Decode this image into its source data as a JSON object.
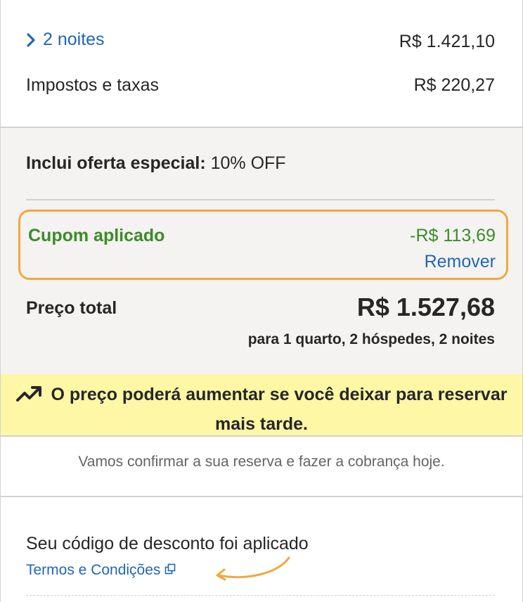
{
  "summary": {
    "nights_label": "2 noites",
    "nights_price": "R$ 1.421,10",
    "taxes_label": "Impostos e taxas",
    "taxes_price": "R$ 220,27"
  },
  "offer": {
    "label": "Inclui oferta especial:",
    "value": "10% OFF"
  },
  "coupon": {
    "label": "Cupom aplicado",
    "value": "-R$ 113,69",
    "remove_label": "Remover"
  },
  "total": {
    "label": "Preço total",
    "value": "R$ 1.527,68",
    "detail": "para 1 quarto, 2 hóspedes, 2 noites"
  },
  "warning": {
    "text": "O preço poderá aumentar se você deixar para reservar mais tarde.",
    "icon": "trending-up-icon"
  },
  "confirmation": {
    "text": "Vamos confirmar a sua reserva e fazer a cobrança hoje."
  },
  "discount": {
    "text": "Seu código de desconto foi aplicado",
    "terms_label": "Termos e Condições",
    "terms_icon": "external-link-icon"
  },
  "colors": {
    "link": "#2167b4",
    "coupon_green": "#3d8a2a",
    "highlight_border": "#f0a840",
    "warning_bg": "#fdf7a6",
    "section_bg": "#f4f3f1"
  }
}
